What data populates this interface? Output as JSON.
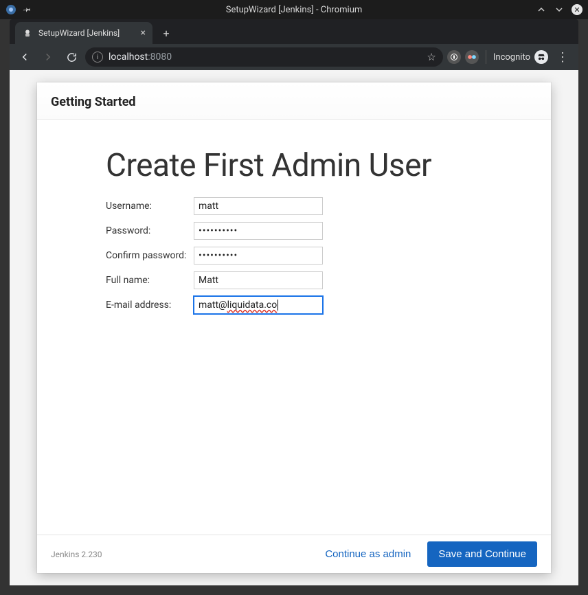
{
  "os": {
    "window_title": "SetupWizard [Jenkins] - Chromium"
  },
  "browser": {
    "tab_title": "SetupWizard [Jenkins]",
    "url_host": "localhost",
    "url_port": ":8080",
    "incognito_label": "Incognito"
  },
  "wizard": {
    "header": "Getting Started",
    "title": "Create First Admin User",
    "fields": {
      "username_label": "Username:",
      "username_value": "matt",
      "password_label": "Password:",
      "password_value": "••••••••••",
      "confirm_label": "Confirm password:",
      "confirm_value": "••••••••••",
      "fullname_label": "Full name:",
      "fullname_value": "Matt",
      "email_label": "E-mail address:",
      "email_value_pre": "matt@",
      "email_value_spell": "liquidata.co"
    },
    "footer": {
      "version": "Jenkins 2.230",
      "continue_as_admin": "Continue as admin",
      "save_and_continue": "Save and Continue"
    }
  }
}
